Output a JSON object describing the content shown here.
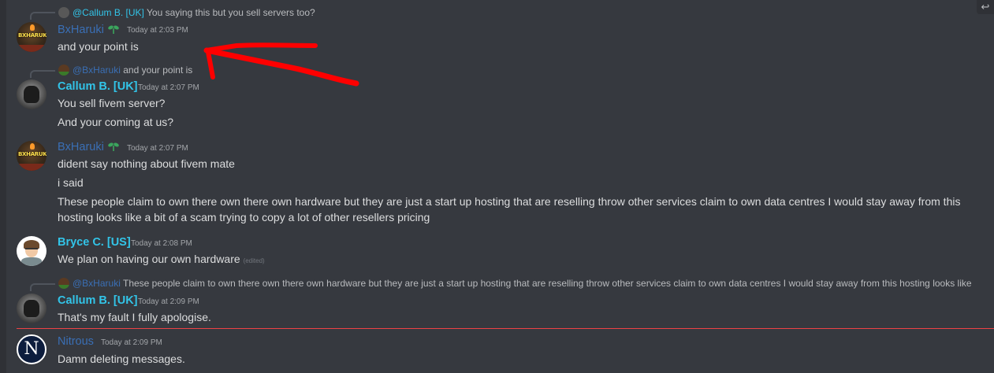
{
  "reply_button_glyph": "↩",
  "messages": [
    {
      "reply": {
        "mention": "@Callum B. [UK]",
        "text": "You saying this but you sell servers too?"
      },
      "author": "BxHaruki",
      "avatar_text": "BXHARUKI",
      "timestamp": "Today at 2:03 PM",
      "lines": [
        "and your point is"
      ]
    },
    {
      "reply": {
        "mention": "@BxHaruki",
        "text": "and your point is"
      },
      "author": "Callum B. [UK]",
      "timestamp": "Today at 2:07 PM",
      "lines": [
        "You sell fivem server?",
        "And your coming at us?"
      ]
    },
    {
      "author": "BxHaruki",
      "avatar_text": "BXHARUKI",
      "timestamp": "Today at 2:07 PM",
      "lines": [
        "dident say nothing about fivem mate",
        "i said",
        "These people claim to own there own there own hardware but they are just a start up hosting that are reselling throw other services claim to own data centres I would stay away from this",
        "hosting looks like a bit of a scam trying to copy a lot of other resellers pricing"
      ]
    },
    {
      "author": "Bryce C. [US]",
      "timestamp": "Today at 2:08 PM",
      "lines": [
        "We plan on having our own hardware"
      ],
      "edited": "(edited)"
    },
    {
      "reply": {
        "mention": "@BxHaruki",
        "text": "These people claim to own there own there own hardware but they are just a start up hosting that are reselling throw other services claim to own data centres I would stay away from this hosting looks like"
      },
      "author": "Callum B. [UK]",
      "timestamp": "Today at 2:09 PM",
      "lines": [
        "That's my fault I fully apologise."
      ]
    },
    {
      "author": "Nitrous",
      "avatar_letter": "N",
      "timestamp": "Today at 2:09 PM",
      "lines": [
        "Damn deleting messages."
      ]
    }
  ],
  "colors": {
    "background": "#36393f",
    "name_blue": "#3a6fb5",
    "name_cyan": "#32c4e8",
    "annotation_arrow": "#ff0000",
    "new_messages_divider": "#ed4245"
  }
}
